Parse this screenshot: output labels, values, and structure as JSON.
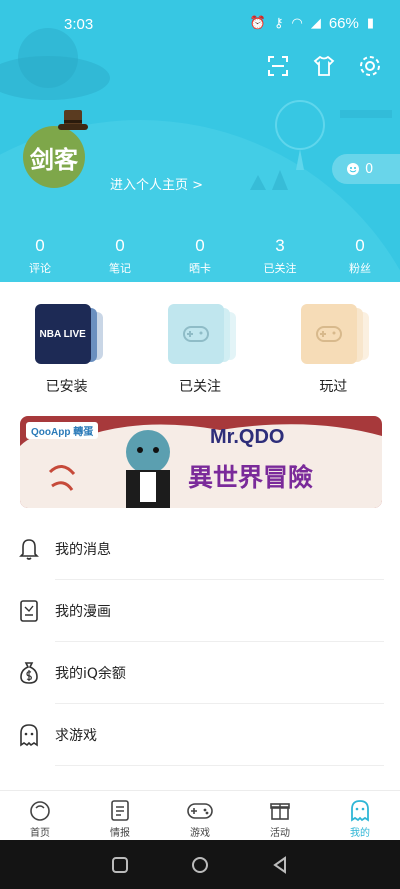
{
  "status_bar": {
    "time": "3:03",
    "battery": "66%"
  },
  "profile": {
    "avatar_text": "剑客",
    "homepage_link": "进入个人主页 >",
    "coins": "0"
  },
  "stats": [
    {
      "value": "0",
      "label": "评论"
    },
    {
      "value": "0",
      "label": "笔记"
    },
    {
      "value": "0",
      "label": "晒卡"
    },
    {
      "value": "3",
      "label": "已关注"
    },
    {
      "value": "0",
      "label": "粉丝"
    }
  ],
  "games": [
    {
      "label": "已安装",
      "cover_text": "NBA LIVE"
    },
    {
      "label": "已关注"
    },
    {
      "label": "玩过"
    }
  ],
  "banner": {
    "brand": "QooApp 轉蛋",
    "title": "Mr.QDO",
    "subtitle": "異世界冒險"
  },
  "menu": [
    {
      "label": "我的消息",
      "icon": "bell-icon"
    },
    {
      "label": "我的漫画",
      "icon": "comic-icon"
    },
    {
      "label": "我的iQ余额",
      "icon": "money-bag-icon"
    },
    {
      "label": "求游戏",
      "icon": "ghost-icon"
    }
  ],
  "nav": [
    {
      "label": "首页",
      "icon": "home-icon"
    },
    {
      "label": "情报",
      "icon": "news-icon"
    },
    {
      "label": "游戏",
      "icon": "gamepad-icon"
    },
    {
      "label": "活动",
      "icon": "gift-icon"
    },
    {
      "label": "我的",
      "icon": "ghost-icon",
      "active": true
    }
  ],
  "colors": {
    "header": "#37c7e3",
    "accent": "#2fb6d6"
  }
}
